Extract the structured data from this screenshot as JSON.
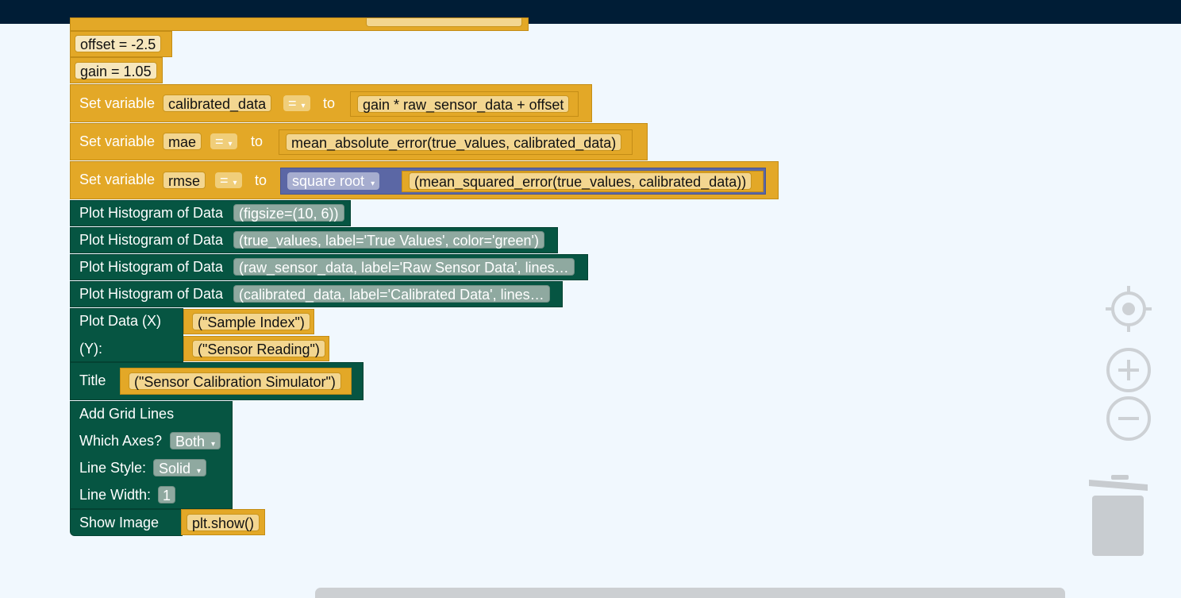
{
  "blocks": {
    "offset": "offset = -2.5",
    "gain": "gain = 1.05",
    "set_calibrated": {
      "label": "Set variable",
      "var": "calibrated_data",
      "op": "=",
      "to": "to",
      "expr": "gain * raw_sensor_data + offset"
    },
    "set_mae": {
      "label": "Set variable",
      "var": "mae",
      "op": "=",
      "to": "to",
      "expr": "mean_absolute_error(true_values, calibrated_data)"
    },
    "set_rmse": {
      "label": "Set variable",
      "var": "rmse",
      "op": "=",
      "to": "to",
      "func": "square root",
      "expr": "(mean_squared_error(true_values, calibrated_data))"
    },
    "hist1": {
      "label": "Plot Histogram of Data",
      "args": "(figsize=(10, 6))"
    },
    "hist2": {
      "label": "Plot Histogram of Data",
      "args": "(true_values, label='True Values', color='green')"
    },
    "hist3": {
      "label": "Plot Histogram of Data",
      "args": "(raw_sensor_data, label='Raw Sensor Data', lines…"
    },
    "hist4": {
      "label": "Plot Histogram of Data",
      "args": "(calibrated_data, label='Calibrated Data', lines…"
    },
    "plot_data": {
      "label_x": "Plot Data (X)",
      "x": "(\"Sample Index\")",
      "label_y": "(Y):",
      "y": "(\"Sensor Reading\")"
    },
    "title": {
      "label": "Title",
      "value": "(\"Sensor Calibration Simulator\")"
    },
    "grid": {
      "label": "Add Grid Lines",
      "axes_label": "Which Axes?",
      "axes_value": "Both",
      "style_label": "Line Style:",
      "style_value": "Solid",
      "width_label": "Line Width:",
      "width_value": "1"
    },
    "show": {
      "label": "Show Image",
      "value": "plt.show()"
    }
  },
  "colors": {
    "topbar": "#001d36",
    "yellow_block": "#e3a827",
    "green_block": "#065542",
    "math_block": "#5b67a5",
    "workspace": "#f1f8fe"
  },
  "controls": [
    "recenter-icon",
    "zoom-in-icon",
    "zoom-out-icon",
    "trash-icon"
  ]
}
